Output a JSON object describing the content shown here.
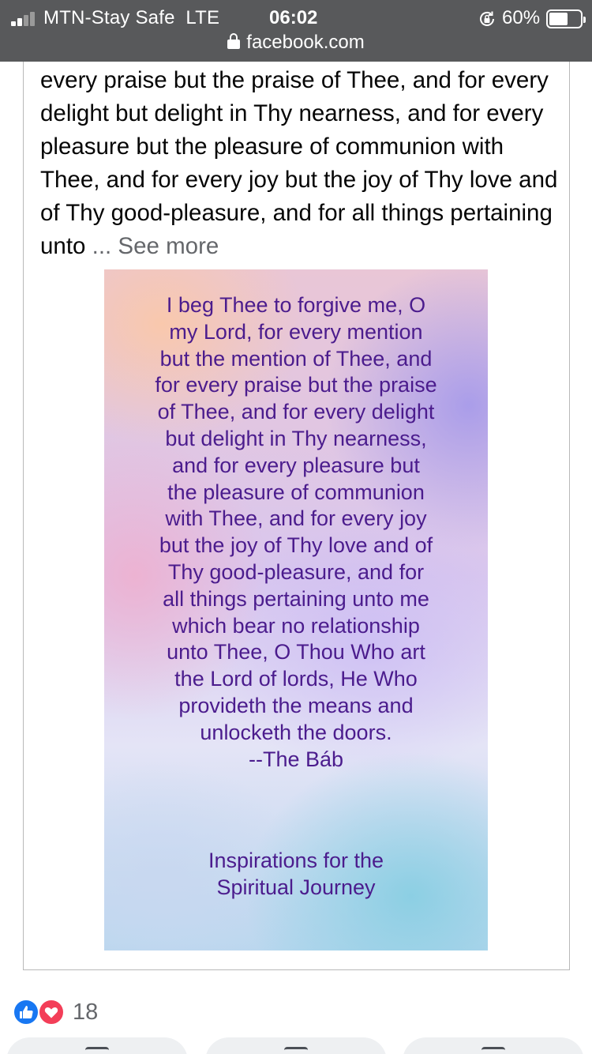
{
  "status_bar": {
    "carrier": "MTN-Stay Safe",
    "network": "LTE",
    "time": "06:02",
    "battery_percent": "60%",
    "battery_level": 0.6,
    "signal_bars": 2,
    "url": "facebook.com",
    "icons": [
      "signal-icon",
      "rotation-lock-icon",
      "battery-icon",
      "lock-icon"
    ]
  },
  "post": {
    "text": "every praise but the praise of Thee, and for every delight but delight in Thy nearness, and for every pleasure but the pleasure of communion with Thee, and for every joy but the joy of Thy love and of Thy good-pleasure, and for all things pertaining unto",
    "ellipsis": "...",
    "see_more_label": "See more",
    "image": {
      "quote_lines": [
        "I beg Thee to forgive me, O",
        "my Lord, for every mention",
        "but the mention of Thee, and",
        "for every praise but the praise",
        "of Thee, and for every delight",
        "but delight in Thy nearness,",
        "and for every pleasure but",
        "the pleasure of communion",
        "with Thee, and for every joy",
        "but the joy of Thy love and of",
        "Thy good-pleasure, and for",
        "all things pertaining unto me",
        "which bear no relationship",
        "unto Thee, O Thou Who art",
        "the Lord of lords, He Who",
        "provideth the means and",
        "unlocketh the doors.",
        "--The Báb"
      ],
      "footer_lines": [
        "Inspirations for the",
        "Spiritual Journey"
      ]
    }
  },
  "reactions": {
    "icons": [
      "like-icon",
      "love-icon"
    ],
    "count": "18"
  },
  "colors": {
    "status_bar_bg": "#58595b",
    "quote_text": "#4b1c8d",
    "like": "#1877f2",
    "love": "#f33e58",
    "secondary_text": "#65676b"
  }
}
